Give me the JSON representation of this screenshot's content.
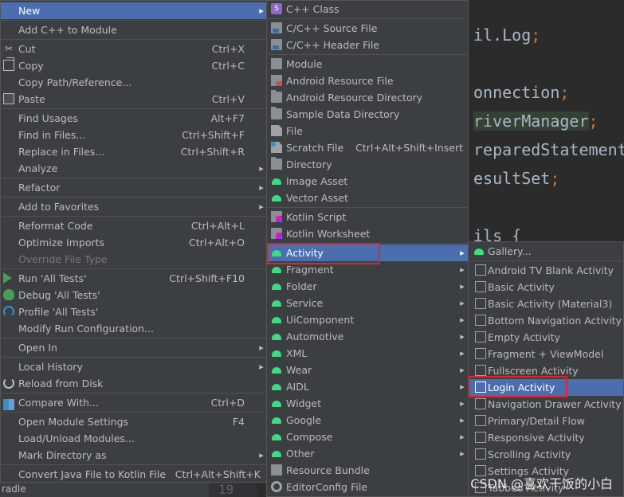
{
  "editor": {
    "lines": [
      {
        "text": "il.Log",
        "semi": ";"
      },
      {
        "text": "onnection",
        "semi": ";"
      },
      {
        "text": "riverManager",
        "semi": ";"
      },
      {
        "text": "reparedStatement",
        "semi": ""
      },
      {
        "text": "esultSet",
        "semi": ";"
      },
      {
        "text": "ils {",
        "semi": ""
      }
    ],
    "line_number": "19",
    "status_fragment": "radle"
  },
  "context_menu": {
    "items": [
      {
        "label": "New",
        "shortcut": "",
        "submenu": true,
        "selected": true
      },
      {
        "label": "Add C++ to Module",
        "shortcut": ""
      },
      {
        "label": "Cut",
        "shortcut": "Ctrl+X",
        "icon": "cut-icon"
      },
      {
        "label": "Copy",
        "shortcut": "Ctrl+C",
        "icon": "copy-icon"
      },
      {
        "label": "Copy Path/Reference...",
        "shortcut": ""
      },
      {
        "label": "Paste",
        "shortcut": "Ctrl+V",
        "icon": "paste-icon"
      },
      {
        "label": "Find Usages",
        "shortcut": "Alt+F7"
      },
      {
        "label": "Find in Files...",
        "shortcut": "Ctrl+Shift+F"
      },
      {
        "label": "Replace in Files...",
        "shortcut": "Ctrl+Shift+R"
      },
      {
        "label": "Analyze",
        "shortcut": "",
        "submenu": true
      },
      {
        "label": "Refactor",
        "shortcut": "",
        "submenu": true
      },
      {
        "label": "Add to Favorites",
        "shortcut": "",
        "submenu": true
      },
      {
        "label": "Reformat Code",
        "shortcut": "Ctrl+Alt+L"
      },
      {
        "label": "Optimize Imports",
        "shortcut": "Ctrl+Alt+O"
      },
      {
        "label": "Override File Type",
        "shortcut": "",
        "disabled": true
      },
      {
        "label": "Run 'All Tests'",
        "shortcut": "Ctrl+Shift+F10",
        "icon": "run-icon"
      },
      {
        "label": "Debug 'All Tests'",
        "shortcut": "",
        "icon": "debug-icon"
      },
      {
        "label": "Profile 'All Tests'",
        "shortcut": "",
        "icon": "profile-icon"
      },
      {
        "label": "Modify Run Configuration...",
        "shortcut": ""
      },
      {
        "label": "Open In",
        "shortcut": "",
        "submenu": true
      },
      {
        "label": "Local History",
        "shortcut": "",
        "submenu": true
      },
      {
        "label": "Reload from Disk",
        "shortcut": "",
        "icon": "reload-icon"
      },
      {
        "label": "Compare With...",
        "shortcut": "Ctrl+D",
        "icon": "compare-icon"
      },
      {
        "label": "Open Module Settings",
        "shortcut": "F4"
      },
      {
        "label": "Load/Unload Modules...",
        "shortcut": ""
      },
      {
        "label": "Mark Directory as",
        "shortcut": "",
        "submenu": true
      },
      {
        "label": "Convert Java File to Kotlin File",
        "shortcut": "Ctrl+Alt+Shift+K"
      }
    ]
  },
  "new_submenu": {
    "items": [
      {
        "label": "C++ Class",
        "icon": "cpp-class-icon"
      },
      {
        "label": "C/C++ Source File",
        "icon": "cpp-source-icon"
      },
      {
        "label": "C/C++ Header File",
        "icon": "cpp-header-icon"
      },
      {
        "label": "Module",
        "icon": "module-icon"
      },
      {
        "label": "Android Resource File",
        "icon": "resource-file-icon"
      },
      {
        "label": "Android Resource Directory",
        "icon": "folder-icon"
      },
      {
        "label": "Sample Data Directory",
        "icon": "folder-icon"
      },
      {
        "label": "File",
        "icon": "file-icon"
      },
      {
        "label": "Scratch File",
        "shortcut": "Ctrl+Alt+Shift+Insert",
        "icon": "scratch-file-icon"
      },
      {
        "label": "Directory",
        "icon": "folder-icon"
      },
      {
        "label": "Image Asset",
        "icon": "android-icon"
      },
      {
        "label": "Vector Asset",
        "icon": "android-icon"
      },
      {
        "label": "Kotlin Script",
        "icon": "kotlin-icon"
      },
      {
        "label": "Kotlin Worksheet",
        "icon": "kotlin-icon"
      },
      {
        "label": "Activity",
        "icon": "android-icon",
        "submenu": true,
        "selected": true
      },
      {
        "label": "Fragment",
        "icon": "android-icon",
        "submenu": true
      },
      {
        "label": "Folder",
        "icon": "android-icon",
        "submenu": true
      },
      {
        "label": "Service",
        "icon": "android-icon",
        "submenu": true
      },
      {
        "label": "UiComponent",
        "icon": "android-icon",
        "submenu": true
      },
      {
        "label": "Automotive",
        "icon": "android-icon",
        "submenu": true
      },
      {
        "label": "XML",
        "icon": "android-icon",
        "submenu": true
      },
      {
        "label": "Wear",
        "icon": "android-icon",
        "submenu": true
      },
      {
        "label": "AIDL",
        "icon": "android-icon",
        "submenu": true
      },
      {
        "label": "Widget",
        "icon": "android-icon",
        "submenu": true
      },
      {
        "label": "Google",
        "icon": "android-icon",
        "submenu": true
      },
      {
        "label": "Compose",
        "icon": "android-icon",
        "submenu": true
      },
      {
        "label": "Other",
        "icon": "android-icon",
        "submenu": true
      },
      {
        "label": "Resource Bundle",
        "icon": "resource-bundle-icon"
      },
      {
        "label": "EditorConfig File",
        "icon": "gear-icon"
      }
    ]
  },
  "activity_submenu": {
    "items": [
      {
        "label": "Gallery...",
        "icon": "android-icon"
      },
      {
        "label": "Android TV Blank Activity",
        "icon": "document-icon"
      },
      {
        "label": "Basic Activity",
        "icon": "document-icon"
      },
      {
        "label": "Basic Activity (Material3)",
        "icon": "document-icon"
      },
      {
        "label": "Bottom Navigation Activity",
        "icon": "document-icon"
      },
      {
        "label": "Empty Activity",
        "icon": "document-icon"
      },
      {
        "label": "Fragment + ViewModel",
        "icon": "document-icon"
      },
      {
        "label": "Fullscreen Activity",
        "icon": "document-icon"
      },
      {
        "label": "Login Activity",
        "icon": "document-icon",
        "selected": true
      },
      {
        "label": "Navigation Drawer Activity",
        "icon": "document-icon"
      },
      {
        "label": "Primary/Detail Flow",
        "icon": "document-icon"
      },
      {
        "label": "Responsive Activity",
        "icon": "document-icon"
      },
      {
        "label": "Scrolling Activity",
        "icon": "document-icon"
      },
      {
        "label": "Settings Activity",
        "icon": "document-icon"
      },
      {
        "label": "Tabbed Activity",
        "icon": "document-icon"
      }
    ]
  },
  "watermark": "CSDN @喜欢干饭的小白",
  "colors": {
    "menu_bg": "#3c3f41",
    "selection": "#4b6eaf",
    "editor_bg": "#2b2b2b",
    "highlight_box": "#e0242c"
  }
}
